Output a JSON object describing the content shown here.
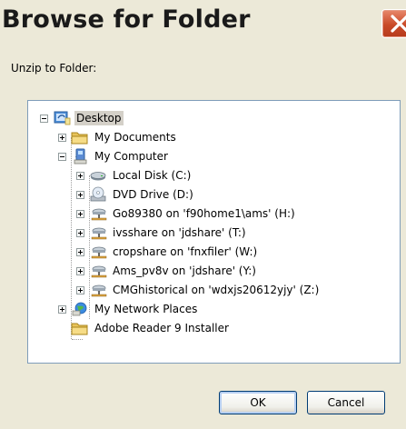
{
  "window": {
    "title": "Browse for Folder"
  },
  "prompt": "Unzip to Folder:",
  "tree": {
    "desktop": "Desktop",
    "my_documents": "My Documents",
    "my_computer": "My Computer",
    "drives": [
      {
        "label": "Local Disk (C:)",
        "icon": "hard-disk-icon"
      },
      {
        "label": "DVD Drive (D:)",
        "icon": "dvd-drive-icon"
      },
      {
        "label": "Go89380 on 'f90home1\\ams' (H:)",
        "icon": "network-drive-icon"
      },
      {
        "label": "ivsshare on 'jdshare' (T:)",
        "icon": "network-drive-icon"
      },
      {
        "label": "cropshare on 'fnxfiler' (W:)",
        "icon": "network-drive-icon"
      },
      {
        "label": "Ams_pv8v on 'jdshare' (Y:)",
        "icon": "network-drive-icon"
      },
      {
        "label": "CMGhistorical on 'wdxjs20612yjy' (Z:)",
        "icon": "network-drive-icon"
      }
    ],
    "network_places": "My Network Places",
    "adobe_installer": "Adobe Reader 9 Installer"
  },
  "buttons": {
    "ok": "OK",
    "cancel": "Cancel"
  }
}
